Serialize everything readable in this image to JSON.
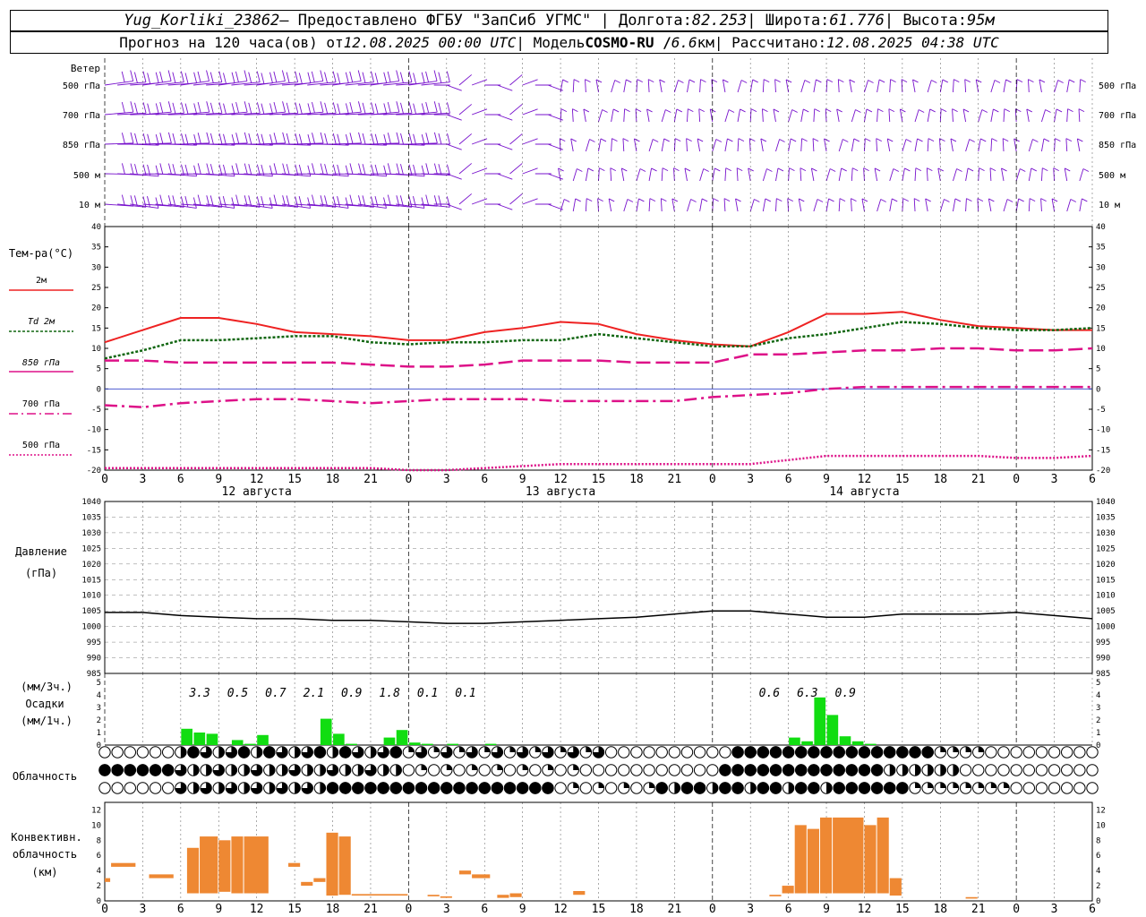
{
  "header": {
    "station": "Yug_Korliki_23862",
    "provider": " – Предоставлено ФГБУ \"ЗапСиб УГМС\" | Долгота: ",
    "lon": "82.253",
    "lat_label": " | Широта: ",
    "lat": "61.776",
    "alt_label": " | Высота: ",
    "alt": "95м",
    "fc_label": "Прогноз на 120 часа(ов) от ",
    "fc_start": "12.08.2025 00:00 UTC",
    "model_label": " | Модель ",
    "model": "COSMO-RU / ",
    "grid": "6.6",
    "grid_unit": "км",
    "calc_label": " | Рассчитано: ",
    "calc": "12.08.2025 04:38 UTC"
  },
  "wind_panel": {
    "title": "Ветер",
    "levels": [
      "500 гПа",
      "700 гПа",
      "850 гПа",
      "500 м",
      "10  м"
    ]
  },
  "temp_panel": {
    "title": "Тем-ра(°C)",
    "legend": [
      {
        "label": "2м",
        "color": "#ee2222",
        "dash": "solid"
      },
      {
        "label": "Td  2м",
        "color": "#116611",
        "dash": "dotted"
      },
      {
        "label": "850 гПа",
        "color": "#dd1188",
        "dash": "long-dash"
      },
      {
        "label": "700 гПа",
        "color": "#dd1188",
        "dash": "dash-dot"
      },
      {
        "label": "500 гПа",
        "color": "#dd1188",
        "dash": "dotted"
      }
    ],
    "yticks": [
      "40",
      "35",
      "30",
      "25",
      "20",
      "15",
      "10",
      "5",
      "0",
      "-5",
      "-10",
      "-15",
      "-20"
    ]
  },
  "time_axis": {
    "hour_labels": [
      "0",
      "3",
      "6",
      "9",
      "12",
      "15",
      "18",
      "21",
      "0",
      "3",
      "6",
      "9",
      "12",
      "15",
      "18",
      "21",
      "0",
      "3",
      "6",
      "9",
      "12",
      "15",
      "18",
      "21",
      "0",
      "3",
      "6"
    ],
    "dates": [
      "12 августа",
      "13 августа",
      "14 августа"
    ]
  },
  "pressure_panel": {
    "title": "Давление",
    "unit": "(гПа)",
    "yticks": [
      "1040",
      "1035",
      "1030",
      "1025",
      "1020",
      "1015",
      "1010",
      "1005",
      "1000",
      "995",
      "990",
      "985"
    ]
  },
  "precip_panel": {
    "unit3": "(мм/3ч.)",
    "title": "Осадки",
    "unit1": "(мм/1ч.)",
    "yticks": [
      "5",
      "4",
      "3",
      "2",
      "1",
      "0"
    ],
    "totals": [
      "3.3",
      "0.5",
      "0.7",
      "2.1",
      "0.9",
      "1.8",
      "0.1",
      "0.1",
      "0.6",
      "6.3",
      "0.9"
    ]
  },
  "cloud_panel": {
    "title": "Облачность"
  },
  "conv_panel": {
    "title1": "Конвективн.",
    "title2": "облачность",
    "unit": "(км)",
    "yticks": [
      "12",
      "10",
      "8",
      "6",
      "4",
      "2",
      "0"
    ]
  },
  "chart_data": [
    {
      "type": "line",
      "name": "temperature",
      "x_hours": [
        0,
        3,
        6,
        9,
        12,
        15,
        18,
        21,
        24,
        27,
        30,
        33,
        36,
        39,
        42,
        45,
        48,
        51,
        54,
        57,
        60,
        63,
        66,
        69,
        72,
        75,
        78
      ],
      "series": [
        {
          "name": "2м",
          "values": [
            11.5,
            14.5,
            17.5,
            17.5,
            16,
            14,
            13.5,
            13,
            12,
            12,
            14,
            15,
            16.5,
            16,
            13.5,
            12,
            11,
            10.5,
            14,
            18.5,
            18.5,
            19,
            17,
            15.5,
            15,
            14.5,
            14.5
          ]
        },
        {
          "name": "Td  2м",
          "values": [
            7.5,
            9.5,
            12,
            12,
            12.5,
            13,
            13,
            11.5,
            11,
            11.5,
            11.5,
            12,
            12,
            13.5,
            12.5,
            11.5,
            10.5,
            10.5,
            12.5,
            13.5,
            15,
            16.5,
            16,
            15,
            14.5,
            14.5,
            15
          ]
        },
        {
          "name": "850 гПа",
          "values": [
            7,
            7,
            6.5,
            6.5,
            6.5,
            6.5,
            6.5,
            6,
            5.5,
            5.5,
            6,
            7,
            7,
            7,
            6.5,
            6.5,
            6.5,
            8.5,
            8.5,
            9,
            9.5,
            9.5,
            10,
            10,
            9.5,
            9.5,
            10
          ]
        },
        {
          "name": "700 гПа",
          "values": [
            -4,
            -4.5,
            -3.5,
            -3,
            -2.5,
            -2.5,
            -3,
            -3.5,
            -3,
            -2.5,
            -2.5,
            -2.5,
            -3,
            -3,
            -3,
            -3,
            -2,
            -1.5,
            -1,
            0,
            0.5,
            0.5,
            0.5,
            0.5,
            0.5,
            0.5,
            0.5
          ]
        },
        {
          "name": "500 гПа",
          "values": [
            -19.5,
            -19.5,
            -19.5,
            -19.5,
            -19.5,
            -19.5,
            -19.5,
            -19.5,
            -20,
            -20,
            -19.5,
            -19,
            -18.5,
            -18.5,
            -18.5,
            -18.5,
            -18.5,
            -18.5,
            -17.5,
            -16.5,
            -16.5,
            -16.5,
            -16.5,
            -16.5,
            -17,
            -17,
            -16.5
          ]
        }
      ],
      "ylim": [
        -20,
        40
      ]
    },
    {
      "type": "line",
      "name": "pressure",
      "x_hours": [
        0,
        3,
        6,
        9,
        12,
        15,
        18,
        21,
        24,
        27,
        30,
        33,
        36,
        39,
        42,
        45,
        48,
        51,
        54,
        57,
        60,
        63,
        66,
        69,
        72,
        75,
        78
      ],
      "values": [
        1004.5,
        1004.5,
        1003.5,
        1003,
        1002.5,
        1002.5,
        1002,
        1002,
        1001.5,
        1001,
        1001,
        1001.5,
        1002,
        1002.5,
        1003,
        1004,
        1005,
        1005,
        1004,
        1003,
        1003,
        1004,
        1004,
        1004,
        1004.5,
        1003.5,
        1002.5
      ],
      "ylim": [
        985,
        1040
      ]
    },
    {
      "type": "bar",
      "name": "precipitation_1h",
      "x_hours": [
        6,
        7,
        8,
        10,
        11,
        12,
        17,
        18,
        19,
        22,
        23,
        24,
        25,
        27,
        30,
        54,
        55,
        56,
        57,
        58,
        59,
        60
      ],
      "values": [
        1.3,
        1.0,
        0.9,
        0.4,
        0.1,
        0.8,
        2.1,
        0.9,
        0.1,
        0.6,
        1.2,
        0.2,
        0.1,
        0.1,
        0.1,
        0.6,
        0.3,
        3.8,
        2.4,
        0.7,
        0.3,
        0.1
      ],
      "ylim": [
        0,
        5
      ]
    },
    {
      "type": "bar",
      "name": "convective_cloud",
      "segments": [
        {
          "h0": 0,
          "h1": 0.5,
          "bottom": 2.5,
          "top": 3
        },
        {
          "h0": 0.5,
          "h1": 2.5,
          "bottom": 4.5,
          "top": 5
        },
        {
          "h0": 3.5,
          "h1": 5.5,
          "bottom": 3,
          "top": 3.5
        },
        {
          "h0": 6.5,
          "h1": 7.5,
          "bottom": 1,
          "top": 7
        },
        {
          "h0": 7.5,
          "h1": 9,
          "bottom": 1,
          "top": 8.5
        },
        {
          "h0": 9,
          "h1": 10,
          "bottom": 1.2,
          "top": 8
        },
        {
          "h0": 10,
          "h1": 11,
          "bottom": 1,
          "top": 8.5
        },
        {
          "h0": 11,
          "h1": 13,
          "bottom": 1,
          "top": 8.5
        },
        {
          "h0": 14.5,
          "h1": 15.5,
          "bottom": 4.5,
          "top": 5
        },
        {
          "h0": 15.5,
          "h1": 16.5,
          "bottom": 2,
          "top": 2.5
        },
        {
          "h0": 16.5,
          "h1": 17.5,
          "bottom": 2.5,
          "top": 3
        },
        {
          "h0": 17.5,
          "h1": 18.5,
          "bottom": 0.7,
          "top": 9
        },
        {
          "h0": 18.5,
          "h1": 19.5,
          "bottom": 0.8,
          "top": 8.5
        },
        {
          "h0": 19.5,
          "h1": 24,
          "bottom": 0.7,
          "top": 0.9
        },
        {
          "h0": 25.5,
          "h1": 26.5,
          "bottom": 0.6,
          "top": 0.8
        },
        {
          "h0": 26.5,
          "h1": 27.5,
          "bottom": 0.4,
          "top": 0.6
        },
        {
          "h0": 28,
          "h1": 29,
          "bottom": 3.5,
          "top": 4
        },
        {
          "h0": 29,
          "h1": 30.5,
          "bottom": 3,
          "top": 3.5
        },
        {
          "h0": 31,
          "h1": 32,
          "bottom": 0.4,
          "top": 0.8
        },
        {
          "h0": 32,
          "h1": 33,
          "bottom": 0.5,
          "top": 1
        },
        {
          "h0": 37,
          "h1": 38,
          "bottom": 0.8,
          "top": 1.3
        },
        {
          "h0": 52.5,
          "h1": 53.5,
          "bottom": 0.6,
          "top": 0.8
        },
        {
          "h0": 53.5,
          "h1": 54.5,
          "bottom": 1,
          "top": 2
        },
        {
          "h0": 54.5,
          "h1": 55.5,
          "bottom": 1,
          "top": 10
        },
        {
          "h0": 55.5,
          "h1": 56.5,
          "bottom": 1,
          "top": 9.5
        },
        {
          "h0": 56.5,
          "h1": 57.5,
          "bottom": 1,
          "top": 11
        },
        {
          "h0": 57.5,
          "h1": 60,
          "bottom": 1,
          "top": 11
        },
        {
          "h0": 60,
          "h1": 61,
          "bottom": 1,
          "top": 10
        },
        {
          "h0": 61,
          "h1": 62,
          "bottom": 1,
          "top": 11
        },
        {
          "h0": 62,
          "h1": 63,
          "bottom": 0.7,
          "top": 3
        },
        {
          "h0": 68,
          "h1": 69,
          "bottom": 0.3,
          "top": 0.5
        }
      ],
      "ylim": [
        0,
        13
      ]
    }
  ]
}
